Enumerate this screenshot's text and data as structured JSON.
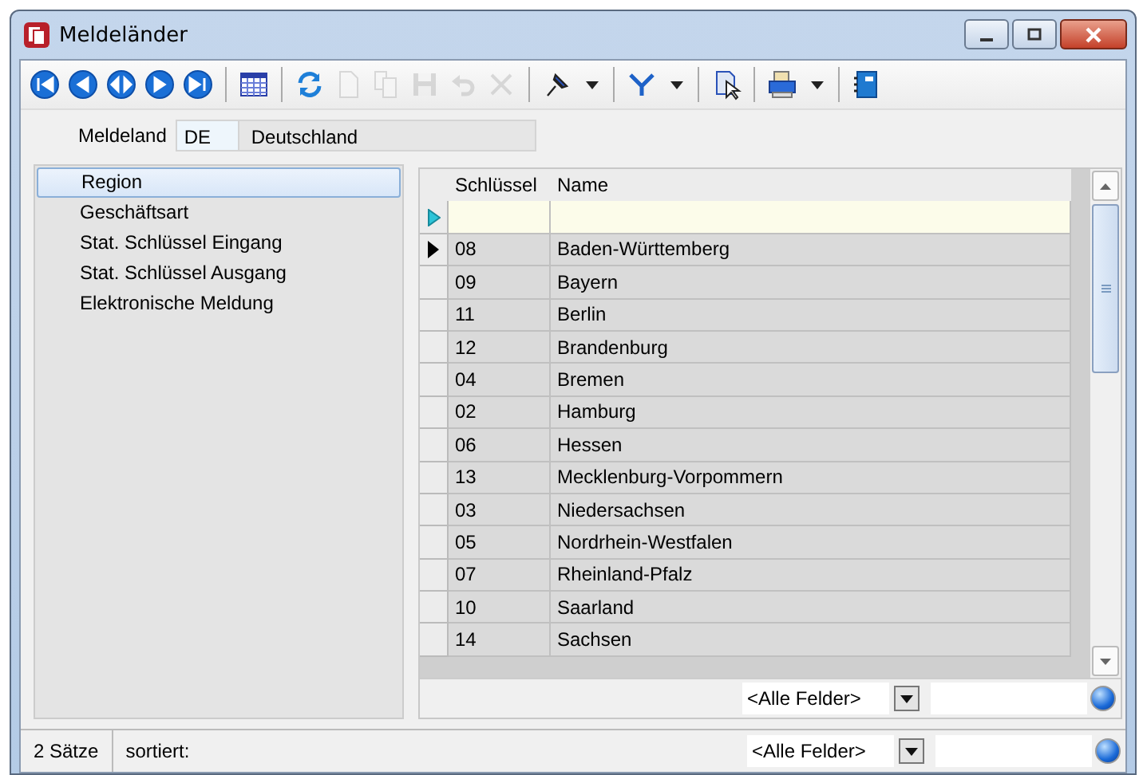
{
  "window": {
    "title": "Meldeländer"
  },
  "toolbar": {
    "groups": [
      [
        {
          "kind": "first",
          "disabled": false,
          "dropdown": false
        },
        {
          "kind": "prev",
          "disabled": false,
          "dropdown": false
        },
        {
          "kind": "middle",
          "disabled": false,
          "dropdown": false
        },
        {
          "kind": "next",
          "disabled": false,
          "dropdown": false
        },
        {
          "kind": "last",
          "disabled": false,
          "dropdown": false
        }
      ],
      [
        {
          "kind": "grid",
          "disabled": false,
          "dropdown": false
        }
      ],
      [
        {
          "kind": "refresh",
          "disabled": false,
          "dropdown": false
        },
        {
          "kind": "new",
          "disabled": true,
          "dropdown": false
        },
        {
          "kind": "copy",
          "disabled": true,
          "dropdown": false
        },
        {
          "kind": "save",
          "disabled": true,
          "dropdown": false
        },
        {
          "kind": "undo",
          "disabled": true,
          "dropdown": false
        },
        {
          "kind": "delete",
          "disabled": true,
          "dropdown": false
        }
      ],
      [
        {
          "kind": "pin",
          "disabled": false,
          "dropdown": true
        }
      ],
      [
        {
          "kind": "filter",
          "disabled": false,
          "dropdown": true
        }
      ],
      [
        {
          "kind": "pointer",
          "disabled": false,
          "dropdown": false
        }
      ],
      [
        {
          "kind": "print",
          "disabled": false,
          "dropdown": true
        }
      ],
      [
        {
          "kind": "book",
          "disabled": false,
          "dropdown": false
        }
      ]
    ]
  },
  "meldeland": {
    "label": "Meldeland",
    "code": "DE",
    "name": "Deutschland"
  },
  "sidebar": {
    "items": [
      {
        "label": "Region",
        "selected": true
      },
      {
        "label": "Geschäftsart",
        "selected": false
      },
      {
        "label": "Stat. Schlüssel Eingang",
        "selected": false
      },
      {
        "label": "Stat. Schlüssel Ausgang",
        "selected": false
      },
      {
        "label": "Elektronische Meldung",
        "selected": false
      }
    ]
  },
  "table": {
    "columns": [
      "Schlüssel",
      "Name"
    ],
    "rows": [
      {
        "kind": "new",
        "current": false,
        "cells": []
      },
      {
        "kind": "data",
        "current": true,
        "cells": [
          "08",
          "Baden-Württemberg"
        ]
      },
      {
        "kind": "data",
        "current": false,
        "cells": [
          "09",
          "Bayern"
        ]
      },
      {
        "kind": "data",
        "current": false,
        "cells": [
          "11",
          "Berlin"
        ]
      },
      {
        "kind": "data",
        "current": false,
        "cells": [
          "12",
          "Brandenburg"
        ]
      },
      {
        "kind": "data",
        "current": false,
        "cells": [
          "04",
          "Bremen"
        ]
      },
      {
        "kind": "data",
        "current": false,
        "cells": [
          "02",
          "Hamburg"
        ]
      },
      {
        "kind": "data",
        "current": false,
        "cells": [
          "06",
          "Hessen"
        ]
      },
      {
        "kind": "data",
        "current": false,
        "cells": [
          "13",
          "Mecklenburg-Vorpommern"
        ]
      },
      {
        "kind": "data",
        "current": false,
        "cells": [
          "03",
          "Niedersachsen"
        ]
      },
      {
        "kind": "data",
        "current": false,
        "cells": [
          "05",
          "Nordrhein-Westfalen"
        ]
      },
      {
        "kind": "data",
        "current": false,
        "cells": [
          "07",
          "Rheinland-Pfalz"
        ]
      },
      {
        "kind": "data",
        "current": false,
        "cells": [
          "10",
          "Saarland"
        ]
      },
      {
        "kind": "data",
        "current": false,
        "cells": [
          "14",
          "Sachsen"
        ]
      }
    ],
    "search": {
      "field": "<Alle Felder>"
    }
  },
  "status_bar": {
    "count": "2 Sätze",
    "sort": "sortiert:",
    "search": {
      "field": "<Alle Felder>"
    }
  }
}
